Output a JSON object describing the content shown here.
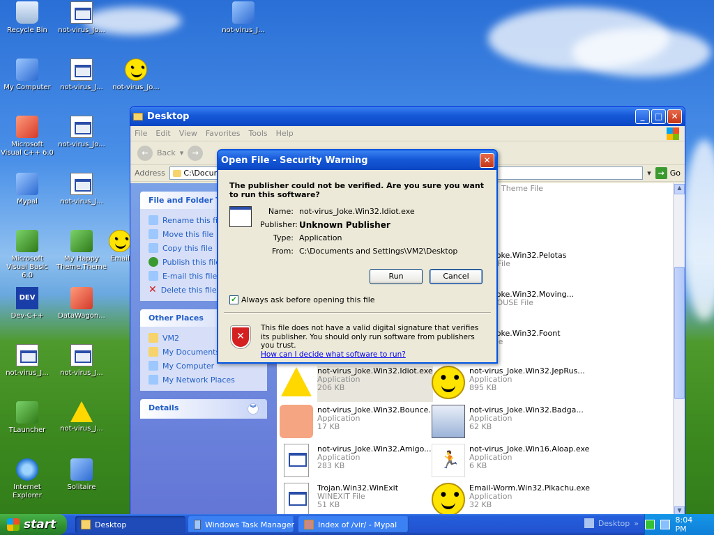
{
  "desktop": {
    "icons": [
      {
        "label": "Recycle Bin",
        "icon": "recycle-bin-icon"
      },
      {
        "label": "not-virus_Jo...",
        "icon": "document-icon"
      },
      {
        "label": "not-virus_J...",
        "icon": "application-icon"
      },
      {
        "label": "My Computer",
        "icon": "computer-icon"
      },
      {
        "label": "not-virus_J...",
        "icon": "document-icon"
      },
      {
        "label": "not-virus_Jo...",
        "icon": "smiley-icon"
      },
      {
        "label": "Microsoft Visual C++ 6.0",
        "icon": "visual-cpp-icon"
      },
      {
        "label": "not-virus_Jo...",
        "icon": "document-icon"
      },
      {
        "label": "Mypal",
        "icon": "mypal-icon"
      },
      {
        "label": "not-virus_J...",
        "icon": "document-icon"
      },
      {
        "label": "Microsoft Visual Basic 6.0",
        "icon": "visual-basic-icon"
      },
      {
        "label": "My Happy Theme.Theme",
        "icon": "theme-icon"
      },
      {
        "label": "Email",
        "icon": "email-icon"
      },
      {
        "label": "Dev-C++",
        "icon": "dev-cpp-icon"
      },
      {
        "label": "DataWagon...",
        "icon": "datawagon-icon"
      },
      {
        "label": "not-virus_J...",
        "icon": "document-icon"
      },
      {
        "label": "not-virus_J...",
        "icon": "document-icon"
      },
      {
        "label": "TLauncher",
        "icon": "tlauncher-icon"
      },
      {
        "label": "not-virus_J...",
        "icon": "warning-icon"
      },
      {
        "label": "Internet Explorer",
        "icon": "internet-explorer-icon"
      },
      {
        "label": "Solitaire",
        "icon": "solitaire-icon"
      }
    ]
  },
  "explorer": {
    "title": "Desktop",
    "menu": [
      "File",
      "Edit",
      "View",
      "Favorites",
      "Tools",
      "Help"
    ],
    "back_label": "Back",
    "address_label": "Address",
    "address_value": "C:\\Documents and Settings\\VM2\\Desktop",
    "go_label": "Go",
    "file_folder_tasks": {
      "title": "File and Folder Tasks",
      "items": [
        "Rename this file",
        "Move this file",
        "Copy this file",
        "Publish this file",
        "E-mail this file",
        "Delete this file"
      ]
    },
    "other_places": {
      "title": "Other Places",
      "items": [
        "VM2",
        "My Documents",
        "My Computer",
        "My Network Places"
      ]
    },
    "details_title": "Details",
    "partial_items": [
      {
        "text": "Theme File"
      },
      {
        "name": "_Joke.Win32.Pelotas",
        "sub": "5 File"
      },
      {
        "name": "_Joke.Win32.Moving...",
        "sub": "MOUSE File"
      },
      {
        "name": "_Joke.Win32.Foont",
        "sub": "File"
      }
    ],
    "files": [
      {
        "name": "not-virus_Joke.Win32.Idiot.exe",
        "type": "Application",
        "size": "206 KB"
      },
      {
        "name": "not-virus_Joke.Win32.JepRus...",
        "type": "Application",
        "size": "895 KB"
      },
      {
        "name": "not-virus_Joke.Win32.Bounce....",
        "type": "Application",
        "size": "17 KB"
      },
      {
        "name": "not-virus_Joke.Win32.Badga...",
        "type": "Application",
        "size": "62 KB"
      },
      {
        "name": "not-virus_Joke.Win32.Amigo....",
        "type": "Application",
        "size": "283 KB"
      },
      {
        "name": "not-virus_Joke.Win16.Aloap.exe",
        "type": "Application",
        "size": "6 KB"
      },
      {
        "name": "Trojan.Win32.WinExit",
        "type": "WINEXIT File",
        "size": "51 KB"
      },
      {
        "name": "Email-Worm.Win32.Pikachu.exe",
        "type": "Application",
        "size": "32 KB"
      }
    ]
  },
  "dialog": {
    "title": "Open File - Security Warning",
    "question": "The publisher could not be verified.  Are you sure you want to run this software?",
    "fields": {
      "name_label": "Name:",
      "name_value": "not-virus_Joke.Win32.Idiot.exe",
      "publisher_label": "Publisher:",
      "publisher_value": "Unknown Publisher",
      "type_label": "Type:",
      "type_value": "Application",
      "from_label": "From:",
      "from_value": "C:\\Documents and Settings\\VM2\\Desktop"
    },
    "run_label": "Run",
    "cancel_label": "Cancel",
    "checkbox_label": "Always ask before opening this file",
    "checkbox_checked": true,
    "warning_text": "This file does not have a valid digital signature that verifies its publisher.  You should only run software from publishers you trust.",
    "help_link": "How can I decide what software to run?"
  },
  "taskbar": {
    "start_label": "start",
    "buttons": [
      "Desktop",
      "Windows Task Manager",
      "Index of /vir/ - Mypal"
    ],
    "deskbar_label": "Desktop",
    "clock": "8:04 PM"
  }
}
